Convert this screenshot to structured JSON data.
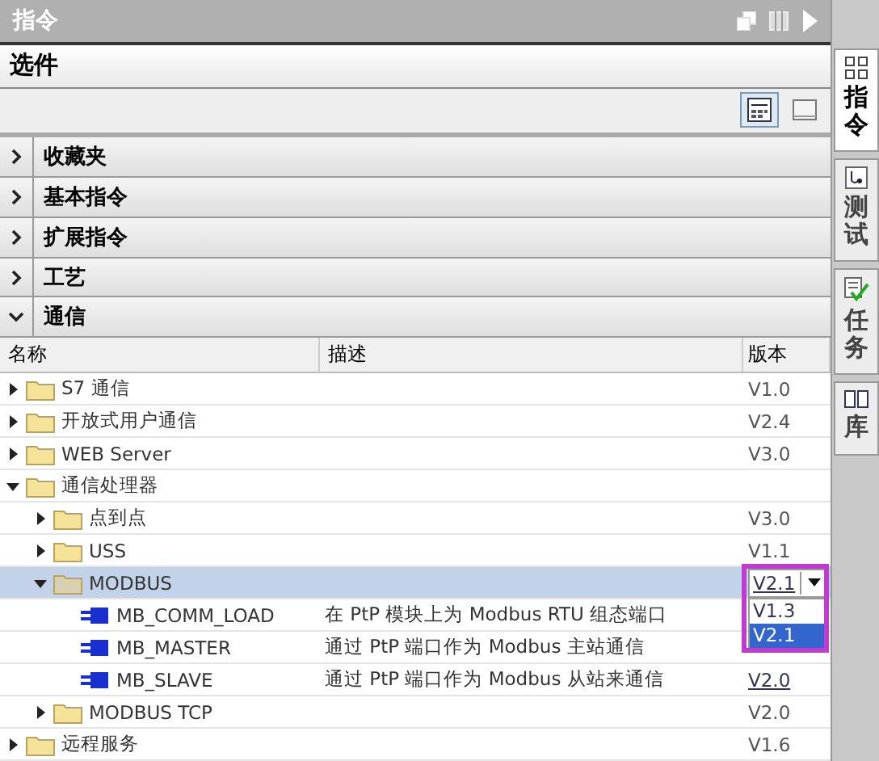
{
  "window": {
    "title": "指令"
  },
  "panel": {
    "title": "选件"
  },
  "toolbar": {
    "buttons": [
      {
        "kind": "columns",
        "selected": true
      },
      {
        "kind": "window",
        "selected": false
      }
    ]
  },
  "sections": [
    {
      "label": "收藏夹",
      "expanded": false
    },
    {
      "label": "基本指令",
      "expanded": false
    },
    {
      "label": "扩展指令",
      "expanded": false
    },
    {
      "label": "工艺",
      "expanded": false
    },
    {
      "label": "通信",
      "expanded": true
    }
  ],
  "table": {
    "columns": [
      "名称",
      "描述",
      "版本"
    ],
    "rows": [
      {
        "kind": "folder",
        "name": "S7 通信",
        "version": "V1.0",
        "expanded": false,
        "selected": false
      },
      {
        "kind": "folder",
        "name": "开放式用户通信",
        "version": "V2.4",
        "expanded": false,
        "selected": false
      },
      {
        "kind": "folder",
        "name": "WEB Server",
        "version": "V3.0",
        "expanded": false,
        "selected": false
      },
      {
        "kind": "folder",
        "name": "通信处理器",
        "expanded": true,
        "selected": false,
        "children": [
          {
            "kind": "folder",
            "name": "点到点",
            "version": "V3.0",
            "expanded": false,
            "selected": false
          },
          {
            "kind": "folder",
            "name": "USS",
            "version": "V1.1",
            "expanded": false,
            "selected": false
          },
          {
            "kind": "folder",
            "name": "MODBUS",
            "version": "V2.1",
            "expanded": true,
            "selected": true,
            "dropdown": {
              "options": [
                {
                  "label": "V1.3",
                  "selected": false
                },
                {
                  "label": "V2.1",
                  "selected": true
                }
              ]
            },
            "children": [
              {
                "kind": "block",
                "name": "MB_COMM_LOAD",
                "description": "在 PtP 模块上为 Modbus RTU 组态端口",
                "selected": false
              },
              {
                "kind": "block",
                "name": "MB_MASTER",
                "description": "通过 PtP 端口作为 Modbus 主站通信",
                "selected": false
              },
              {
                "kind": "block",
                "name": "MB_SLAVE",
                "description": "通过 PtP 端口作为 Modbus 从站来通信",
                "version": "V2.0",
                "selected": false
              }
            ]
          },
          {
            "kind": "folder",
            "name": "MODBUS TCP",
            "version": "V2.0",
            "expanded": false,
            "selected": false
          }
        ]
      },
      {
        "kind": "folder",
        "name": "远程服务",
        "version": "V1.6",
        "expanded": false,
        "selected": false
      }
    ]
  },
  "side_tabs": [
    {
      "label": "指令",
      "kind": "instructions",
      "selected": true
    },
    {
      "label": "测试",
      "kind": "testing",
      "selected": false
    },
    {
      "label": "任务",
      "kind": "tasks",
      "selected": false
    },
    {
      "label": "库",
      "kind": "library",
      "selected": false
    }
  ]
}
